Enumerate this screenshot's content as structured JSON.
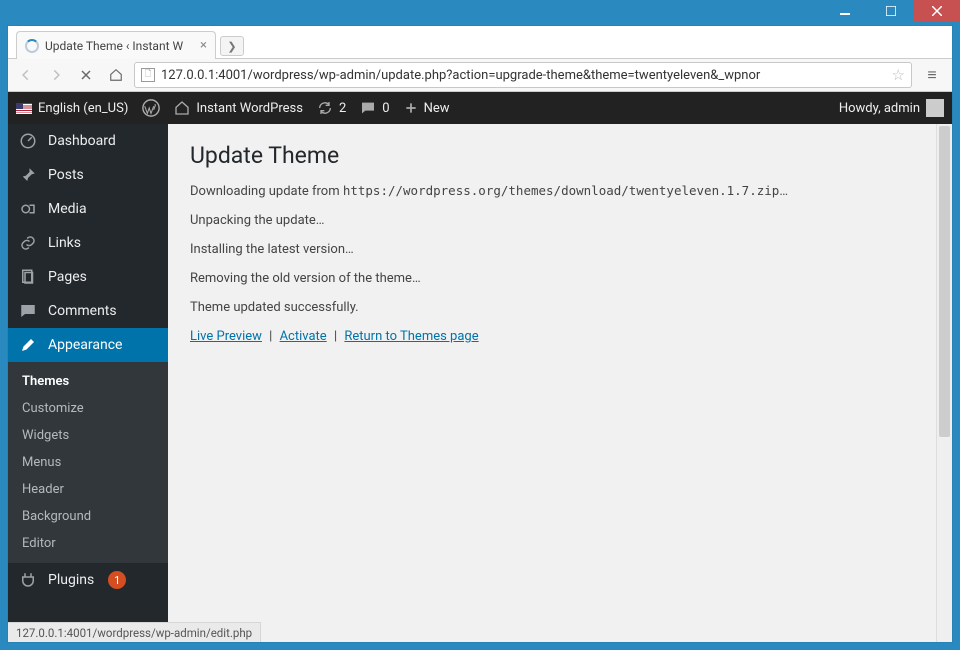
{
  "browser": {
    "tab_title": "Update Theme ‹ Instant W",
    "url_display": "127.0.0.1:4001/wordpress/wp-admin/update.php?action=upgrade-theme&theme=twentyeleven&_wpnor",
    "status_url": "127.0.0.1:4001/wordpress/wp-admin/edit.php"
  },
  "adminbar": {
    "language": "English (en_US)",
    "site_name": "Instant WordPress",
    "updates_count": "2",
    "comments_count": "0",
    "new_label": "New",
    "howdy": "Howdy, admin"
  },
  "menu": {
    "dashboard": "Dashboard",
    "posts": "Posts",
    "media": "Media",
    "links": "Links",
    "pages": "Pages",
    "comments": "Comments",
    "appearance": "Appearance",
    "plugins": "Plugins",
    "plugins_updates": "1",
    "appearance_sub": {
      "themes": "Themes",
      "customize": "Customize",
      "widgets": "Widgets",
      "menus": "Menus",
      "header": "Header",
      "background": "Background",
      "editor": "Editor"
    }
  },
  "content": {
    "heading": "Update Theme",
    "line1_prefix": "Downloading update from ",
    "line1_url": "https://wordpress.org/themes/download/twentyeleven.1.7.zip",
    "line1_suffix": "…",
    "line2": "Unpacking the update…",
    "line3": "Installing the latest version…",
    "line4": "Removing the old version of the theme…",
    "line5": "Theme updated successfully.",
    "link_preview": "Live Preview",
    "link_activate": "Activate",
    "link_return": "Return to Themes page",
    "separator": "|"
  }
}
